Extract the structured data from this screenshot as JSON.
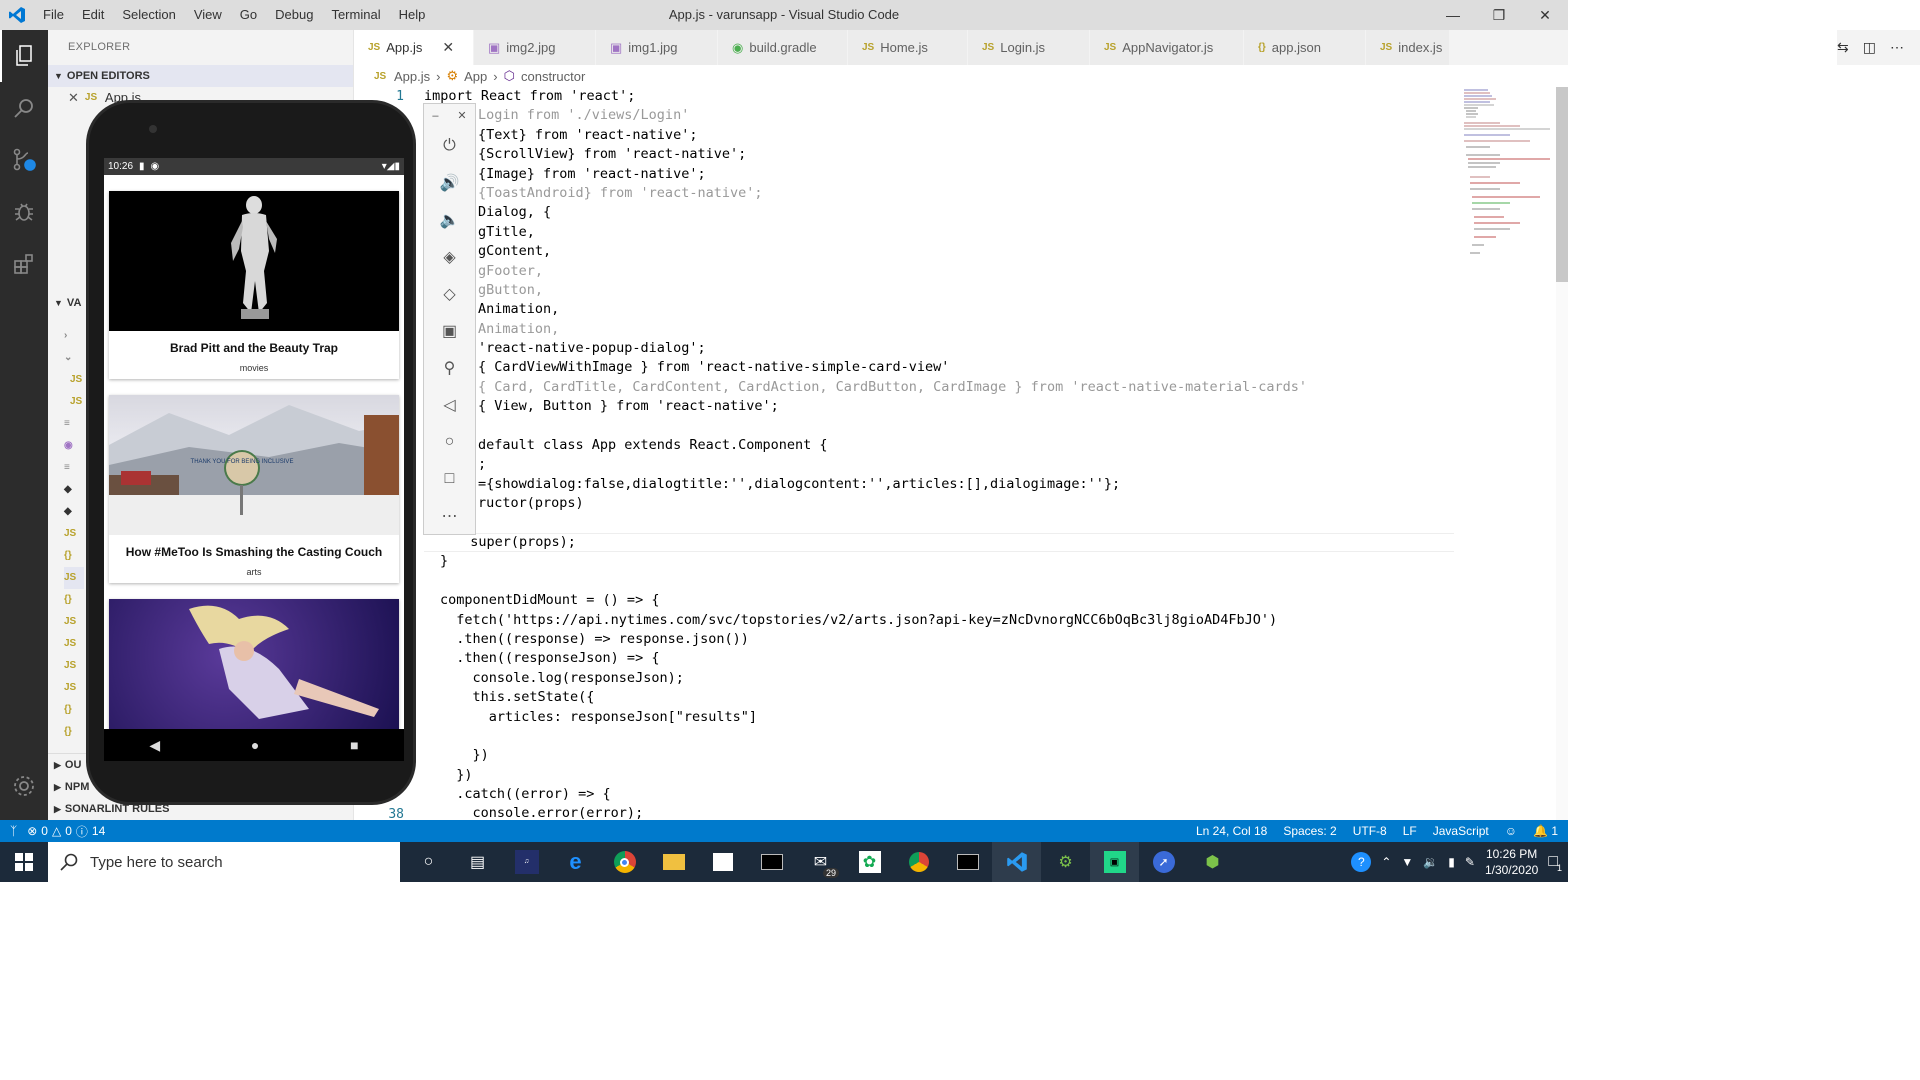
{
  "window": {
    "title": "App.js - varunsapp - Visual Studio Code",
    "menu": [
      "File",
      "Edit",
      "Selection",
      "View",
      "Go",
      "Debug",
      "Terminal",
      "Help"
    ]
  },
  "sidebar": {
    "title": "EXPLORER",
    "open_editors": "OPEN EDITORS",
    "open_file": "App.js",
    "section_va": "VA",
    "outline": "OU",
    "npm": "NPM",
    "sonarlint": "SONARLINT RULES"
  },
  "tabs": [
    {
      "icon": "JS",
      "label": "App.js"
    },
    {
      "icon": "img",
      "label": "img2.jpg"
    },
    {
      "icon": "img",
      "label": "img1.jpg"
    },
    {
      "icon": "gradle",
      "label": "build.gradle"
    },
    {
      "icon": "JS",
      "label": "Home.js"
    },
    {
      "icon": "JS",
      "label": "Login.js"
    },
    {
      "icon": "JS",
      "label": "AppNavigator.js"
    },
    {
      "icon": "{}",
      "label": "app.json"
    },
    {
      "icon": "JS",
      "label": "index.js"
    }
  ],
  "breadcrumb": {
    "file": "App.js",
    "cls": "App",
    "member": "constructor"
  },
  "gutter": {
    "first": "1",
    "last": "38"
  },
  "code_lines": [
    "import React from 'react';",
    "Login from './views/Login'",
    "{Text} from 'react-native';",
    "{ScrollView} from 'react-native';",
    "{Image} from 'react-native';",
    "{ToastAndroid} from 'react-native';",
    "Dialog, {",
    "gTitle,",
    "gContent,",
    "gFooter,",
    "gButton,",
    "Animation,",
    "Animation,",
    "'react-native-popup-dialog';",
    "{ CardViewWithImage } from 'react-native-simple-card-view'",
    "{ Card, CardTitle, CardContent, CardAction, CardButton, CardImage } from 'react-native-material-cards'",
    "{ View, Button } from 'react-native';",
    "",
    "default class App extends React.Component {",
    ";",
    "={showdialog:false,dialogtitle:'',dialogcontent:'',articles:[],dialogimage:''};",
    "ructor(props)",
    "",
    "  super(props);",
    "}",
    "",
    "componentDidMount = () => {",
    "  fetch('https://api.nytimes.com/svc/topstories/v2/arts.json?api-key=zNcDvnorgNCC6bOqBc3lj8gioAD4FbJO')",
    "  .then((response) => response.json())",
    "  .then((responseJson) => {",
    "    console.log(responseJson);",
    "    this.setState({",
    "      articles: responseJson[\"results\"]",
    "",
    "    })",
    "  })",
    "  .catch((error) => {",
    "    console.error(error);"
  ],
  "phone": {
    "time": "10:26",
    "cards": [
      {
        "title": "Brad Pitt and the Beauty Trap",
        "section": "movies"
      },
      {
        "title": "How #MeToo Is Smashing the Casting Couch",
        "section": "arts"
      }
    ],
    "sign_text": "THANK YOU FOR BEING INCLUSIVE"
  },
  "status": {
    "errors": "0",
    "warnings": "0",
    "info": "14",
    "position": "Ln 24, Col 18",
    "spaces": "Spaces: 2",
    "encoding": "UTF-8",
    "eol": "LF",
    "language": "JavaScript",
    "notifications": "1"
  },
  "taskbar": {
    "search_placeholder": "Type here to search",
    "mail_badge": "29",
    "time": "10:26 PM",
    "date": "1/30/2020",
    "notif_count": "1"
  },
  "colors": {
    "accent": "#007acc",
    "activity_bar": "#2c2c2c",
    "taskbar": "#1c2a3a"
  }
}
